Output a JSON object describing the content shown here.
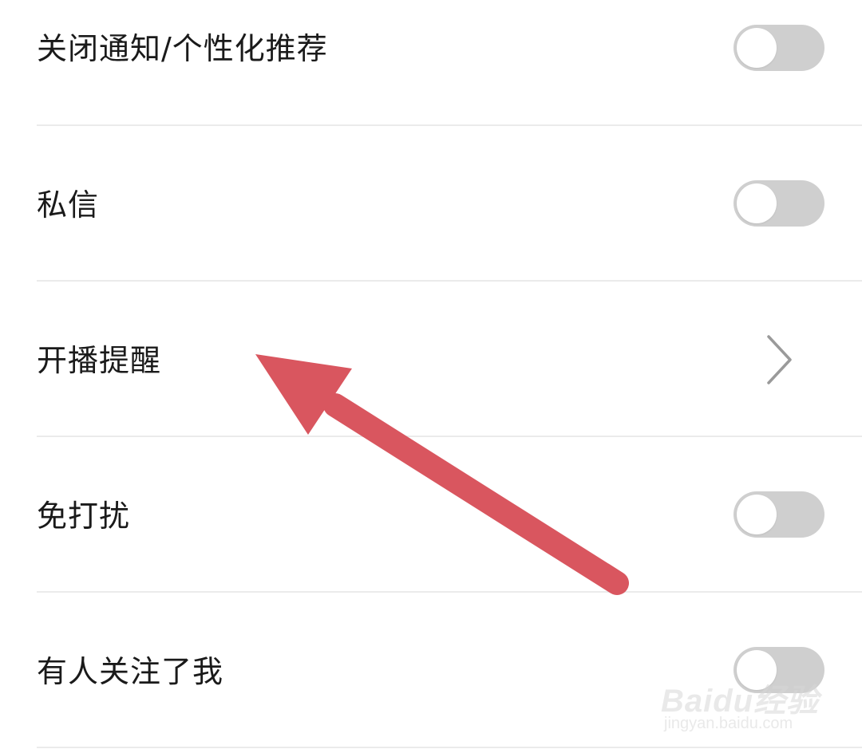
{
  "settings": {
    "items": [
      {
        "label": "关闭通知/个性化推荐",
        "control": "toggle",
        "on": false
      },
      {
        "label": "私信",
        "control": "toggle",
        "on": false
      },
      {
        "label": "开播提醒",
        "control": "chevron"
      },
      {
        "label": "免打扰",
        "control": "toggle",
        "on": false
      },
      {
        "label": "有人关注了我",
        "control": "toggle",
        "on": false
      }
    ]
  },
  "annotation": {
    "arrow_color": "#d9565f"
  },
  "watermark": {
    "logo": "Baidu经验",
    "url": "jingyan.baidu.com"
  },
  "colors": {
    "toggle_off": "#cfcfcf",
    "divider": "#ebebeb",
    "text": "#1a1a1a"
  }
}
